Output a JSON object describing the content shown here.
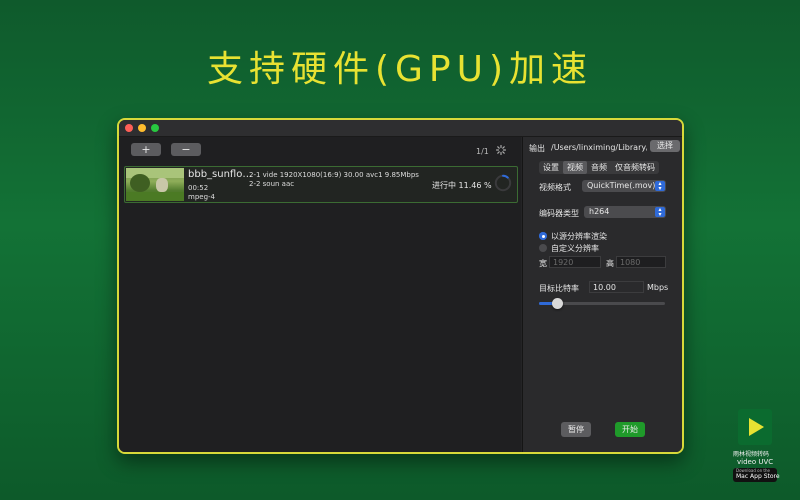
{
  "headline": "支持硬件(GPU)加速",
  "left_panel": {
    "add_button": "+",
    "remove_button": "−",
    "count": "1/1",
    "task": {
      "name": "bbb_sunflo…",
      "duration": "00:52",
      "codec": "mpeg-4",
      "stream1": "2-1 vide 1920X1080(16:9) 30.00 avc1 9.85Mbps",
      "stream2": "2-2 soun aac",
      "status": "进行中 11.46 %",
      "progress_percent": 11.46
    }
  },
  "right_panel": {
    "output_label": "输出",
    "output_path": "/Users/linximing/Library/(",
    "choose_button": "选择",
    "tabs": [
      "设置",
      "视频",
      "音频",
      "仅音频转码"
    ],
    "active_tab": "视频",
    "video_format_label": "视频格式",
    "video_format_value": "QuickTime(.mov)",
    "encoder_label": "编码器类型",
    "encoder_value": "h264",
    "radio_source": "以源分辨率渲染",
    "radio_custom": "自定义分辨率",
    "width_label": "宽",
    "width_value": "1920",
    "height_label": "高",
    "height_value": "1080",
    "bitrate_label": "目标比特率",
    "bitrate_value": "10.00",
    "bitrate_unit": "Mbps",
    "bitrate_slider_fraction": 0.14,
    "pause_button": "暂停",
    "start_button": "开始"
  },
  "badge": {
    "app_name": "雨林视频转码",
    "app_subtitle": "video UVC",
    "store_text": "Mac App Store",
    "store_small": "Download on the"
  },
  "colors": {
    "accent": "#2f6ad8",
    "headline": "#e8e232",
    "start_button": "#1f9a2a",
    "window_border": "#d7d93a"
  }
}
